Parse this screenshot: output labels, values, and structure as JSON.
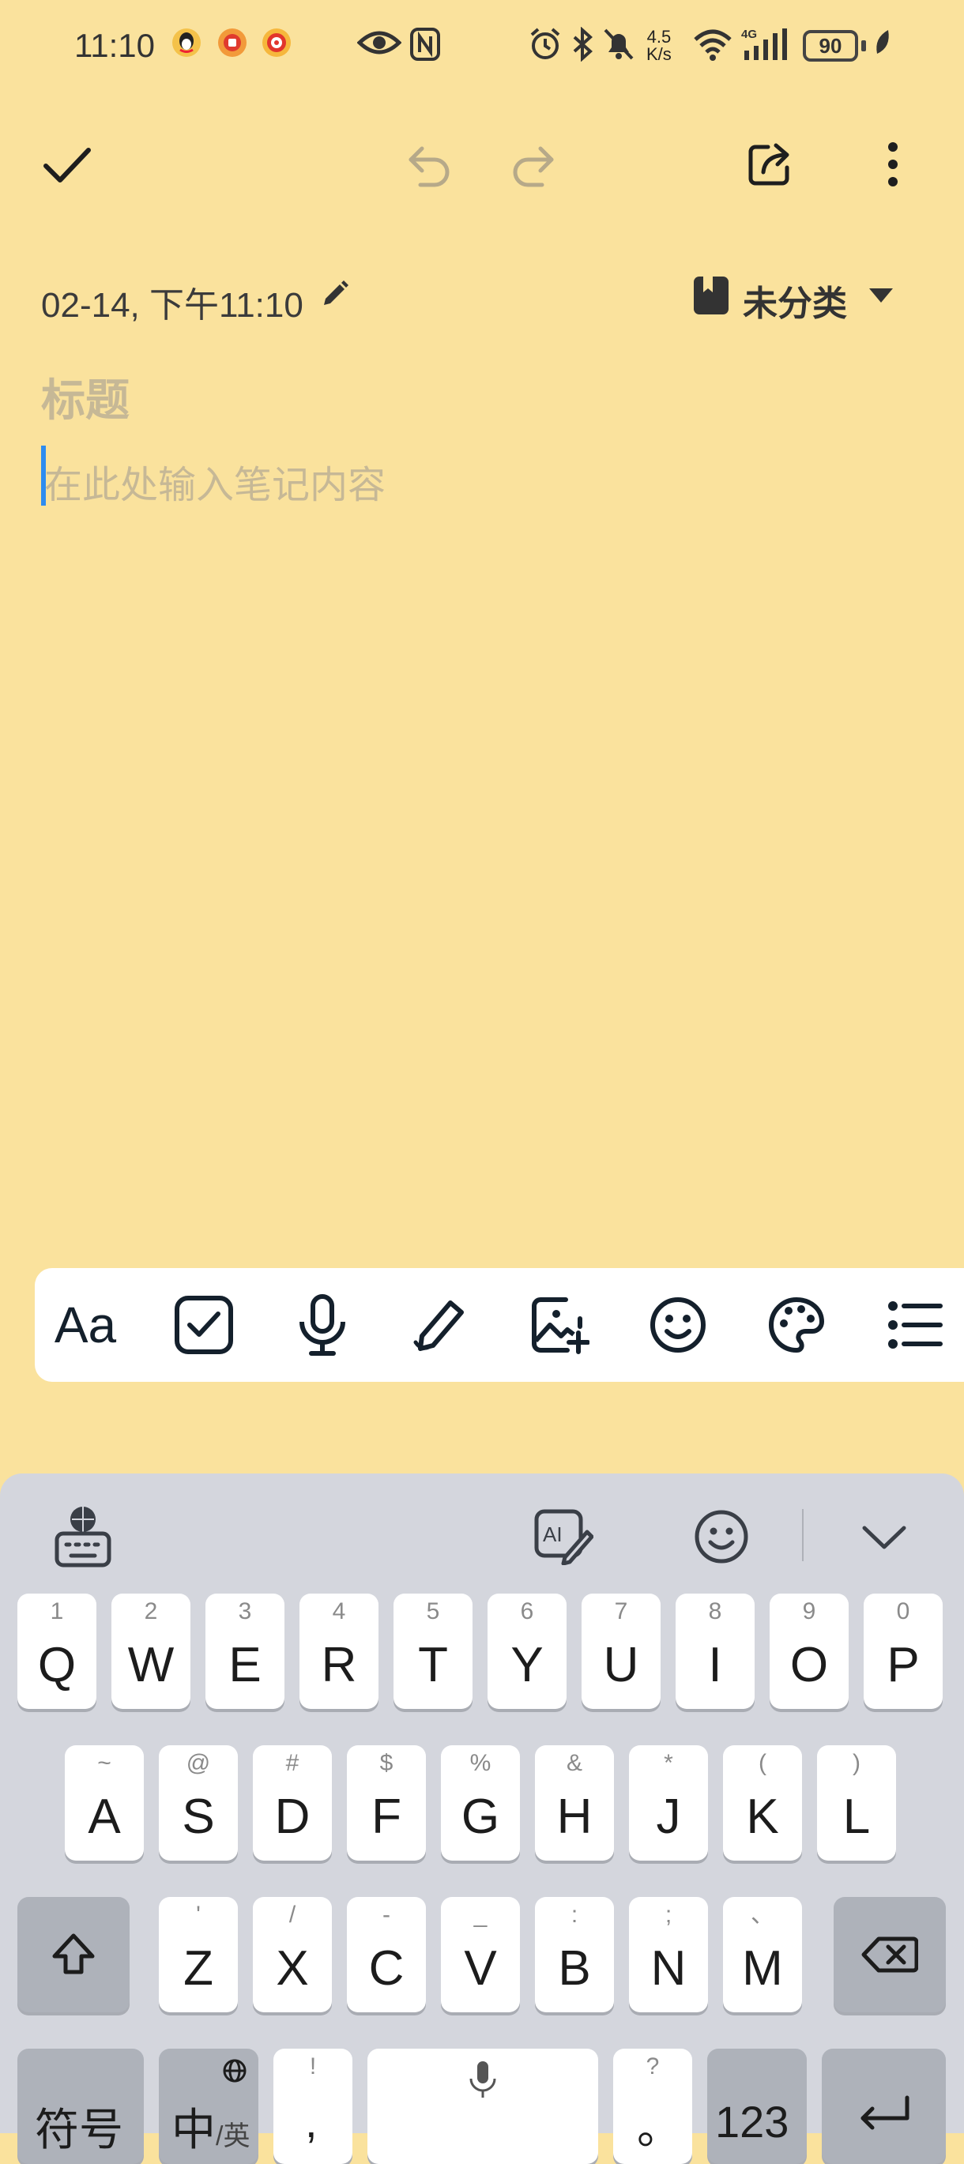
{
  "status_bar": {
    "time": "11:10",
    "net_speed_value": "4.5",
    "net_speed_unit": "K/s",
    "battery": "90",
    "icons": [
      "qq-icon",
      "app-icon",
      "target-icon",
      "eye-icon",
      "nfc-icon",
      "alarm-icon",
      "bluetooth-icon",
      "mute-icon",
      "wifi-icon",
      "4g-signal-icon",
      "leaf-icon"
    ]
  },
  "toolbar": {
    "icons": [
      "check-icon",
      "undo-icon",
      "redo-icon",
      "share-icon",
      "more-icon"
    ]
  },
  "meta": {
    "date": "02-14, 下午11:10",
    "folder": "未分类"
  },
  "editor": {
    "title_placeholder": "标题",
    "body_placeholder": "在此处输入笔记内容"
  },
  "format_bar": {
    "text_style_label": "Aa",
    "icons": [
      "text-style-icon",
      "checklist-icon",
      "microphone-icon",
      "handwriting-icon",
      "add-image-icon",
      "emoji-icon",
      "palette-icon",
      "list-icon"
    ]
  },
  "keyboard": {
    "row1": [
      {
        "main": "Q",
        "sub": "1"
      },
      {
        "main": "W",
        "sub": "2"
      },
      {
        "main": "E",
        "sub": "3"
      },
      {
        "main": "R",
        "sub": "4"
      },
      {
        "main": "T",
        "sub": "5"
      },
      {
        "main": "Y",
        "sub": "6"
      },
      {
        "main": "U",
        "sub": "7"
      },
      {
        "main": "I",
        "sub": "8"
      },
      {
        "main": "O",
        "sub": "9"
      },
      {
        "main": "P",
        "sub": "0"
      }
    ],
    "row2": [
      {
        "main": "A",
        "sub": "~"
      },
      {
        "main": "S",
        "sub": "@"
      },
      {
        "main": "D",
        "sub": "#"
      },
      {
        "main": "F",
        "sub": "$"
      },
      {
        "main": "G",
        "sub": "%"
      },
      {
        "main": "H",
        "sub": "&"
      },
      {
        "main": "J",
        "sub": "*"
      },
      {
        "main": "K",
        "sub": "("
      },
      {
        "main": "L",
        "sub": ")"
      }
    ],
    "row3": [
      {
        "main": "Z",
        "sub": "'"
      },
      {
        "main": "X",
        "sub": "/"
      },
      {
        "main": "C",
        "sub": "-"
      },
      {
        "main": "V",
        "sub": "_"
      },
      {
        "main": "B",
        "sub": ":"
      },
      {
        "main": "N",
        "sub": ";"
      },
      {
        "main": "M",
        "sub": "、"
      }
    ],
    "bottom": {
      "symbols": "符号",
      "lang_main": "中",
      "lang_sub": "/英",
      "comma_main": ",",
      "comma_sub": "!",
      "period_main": "。",
      "period_sub": "?",
      "numbers": "123"
    }
  }
}
